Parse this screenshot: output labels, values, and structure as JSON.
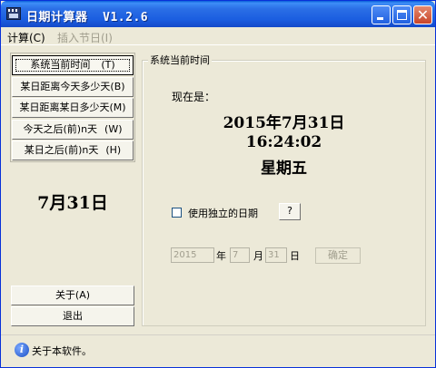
{
  "window": {
    "title": "日期计算器  V1.2.6",
    "minimize_label": "",
    "maximize_label": "",
    "close_label": "✕"
  },
  "menu": {
    "calc": "计算(C)",
    "insert_holiday": "插入节日(I)"
  },
  "left_buttons": [
    {
      "label": "系统当前时间",
      "shortcut": "(T)"
    },
    {
      "label": "某日距离今天多少天",
      "shortcut": "(B)"
    },
    {
      "label": "某日距离某日多少天",
      "shortcut": "(M)"
    },
    {
      "label": "今天之后(前)n天",
      "shortcut": "(W)"
    },
    {
      "label": "某日之后(前)n天",
      "shortcut": "(H)"
    }
  ],
  "big_date": "7月31日",
  "bottom_buttons": {
    "about": "关于(A)",
    "exit": "退出"
  },
  "panel": {
    "group_title": "系统当前时间",
    "now_label": "现在是：",
    "date": "2015年7月31日",
    "time": "16:24:02",
    "weekday": "星期五",
    "use_independent_date": "使用独立的日期",
    "help_button": "?",
    "year_value": "2015",
    "year_unit": "年",
    "month_value": "7",
    "month_unit": "月",
    "day_value": "31",
    "day_unit": "日",
    "ok_button": "确定"
  },
  "status": {
    "text": "关于本软件。"
  }
}
